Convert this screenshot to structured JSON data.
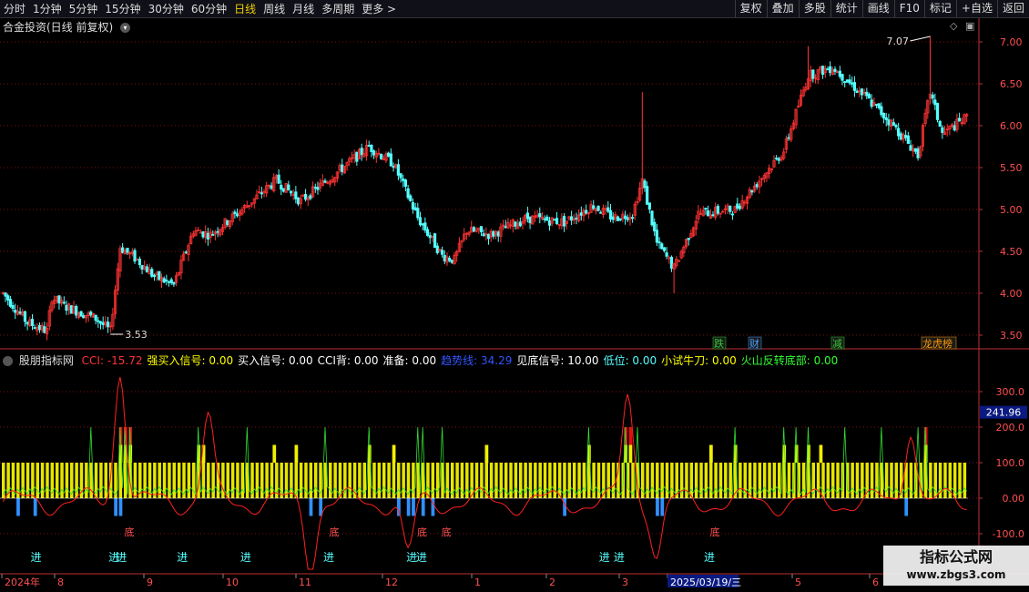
{
  "toolbar": {
    "periods": [
      "分时",
      "1分钟",
      "5分钟",
      "15分钟",
      "30分钟",
      "60分钟",
      "日线",
      "周线",
      "月线",
      "多周期",
      "更多 >"
    ],
    "active_period": "日线",
    "tools": [
      "复权",
      "叠加",
      "多股",
      "统计",
      "画线",
      "F10",
      "标记",
      "+自选",
      "返回"
    ]
  },
  "main_chart": {
    "title": "合金投资(日线 前复权)",
    "price_labels": [
      "7.00",
      "6.50",
      "6.00",
      "5.50",
      "5.00",
      "4.50",
      "4.00",
      "3.50"
    ],
    "high_annotation": "7.07",
    "low_annotation": "3.53",
    "event_tags": [
      {
        "text": "跌",
        "color": "#33cc33"
      },
      {
        "text": "财",
        "color": "#4aa0ff"
      },
      {
        "text": "减",
        "color": "#33cc33"
      },
      {
        "text": "龙虎榜",
        "color": "#ff9900"
      }
    ],
    "colors": {
      "up": "#ff3333",
      "down": "#54ffff",
      "grid": "#7a1010",
      "axis": "#c03030"
    }
  },
  "indicator": {
    "name": "股朋指标网",
    "items": [
      {
        "label": "CCI: -15.72",
        "color": "#ff3333"
      },
      {
        "label": "强买入信号: 0.00",
        "color": "#ffff00"
      },
      {
        "label": "买入信号: 0.00",
        "color": "#ffffff"
      },
      {
        "label": "CCI背: 0.00",
        "color": "#ffffff"
      },
      {
        "label": "准备: 0.00",
        "color": "#ffffff"
      },
      {
        "label": "趋势线: 34.29",
        "color": "#3355ff"
      },
      {
        "label": "见底信号: 10.00",
        "color": "#ffffff"
      },
      {
        "label": "低位: 0.00",
        "color": "#54ffff"
      },
      {
        "label": "小试牛刀: 0.00",
        "color": "#ffff00"
      },
      {
        "label": "火山反转底部: 0.00",
        "color": "#33ff33"
      }
    ],
    "axis_labels": [
      "300.0",
      "200.0",
      "100.0",
      "0.00",
      "-100.0"
    ],
    "current_value": "241.96",
    "signal_text_entry": "进",
    "signal_text_bottom": "底"
  },
  "date_axis": {
    "labels": [
      "2024年",
      "8",
      "9",
      "10",
      "11",
      "12",
      "1",
      "2",
      "3",
      "2025/03/19/三",
      "5",
      "6"
    ]
  },
  "watermark": {
    "line1": "指标公式网",
    "line2": "www.zbgs3.com"
  }
}
